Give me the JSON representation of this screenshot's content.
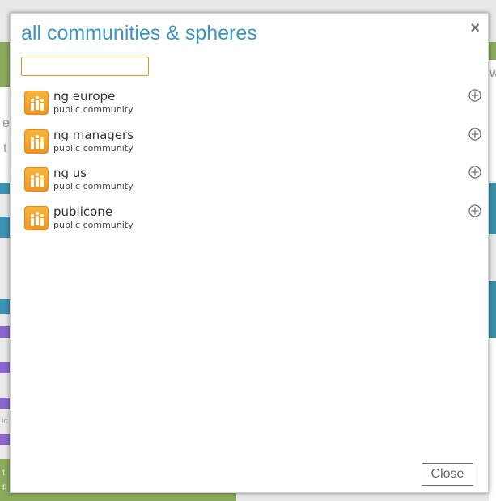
{
  "modal": {
    "title": "all communities & spheres",
    "close_glyph": "×",
    "search": {
      "value": "",
      "placeholder": ""
    },
    "items": [
      {
        "name": "ng europe",
        "type": "public community",
        "icon": "community-icon",
        "action_icon": "add-circle-icon"
      },
      {
        "name": "ng managers",
        "type": "public community",
        "icon": "community-icon",
        "action_icon": "add-circle-icon"
      },
      {
        "name": "ng us",
        "type": "public community",
        "icon": "community-icon",
        "action_icon": "add-circle-icon"
      },
      {
        "name": "publicone",
        "type": "public community",
        "icon": "community-icon",
        "action_icon": "add-circle-icon"
      }
    ],
    "close_label": "Close"
  },
  "background": {
    "fragments": [
      "e",
      "t",
      "w",
      "ic",
      "t",
      "p"
    ]
  },
  "colors": {
    "title": "#3b95c0",
    "icon_orange": "#f5a623",
    "search_border": "#d19a2d"
  }
}
